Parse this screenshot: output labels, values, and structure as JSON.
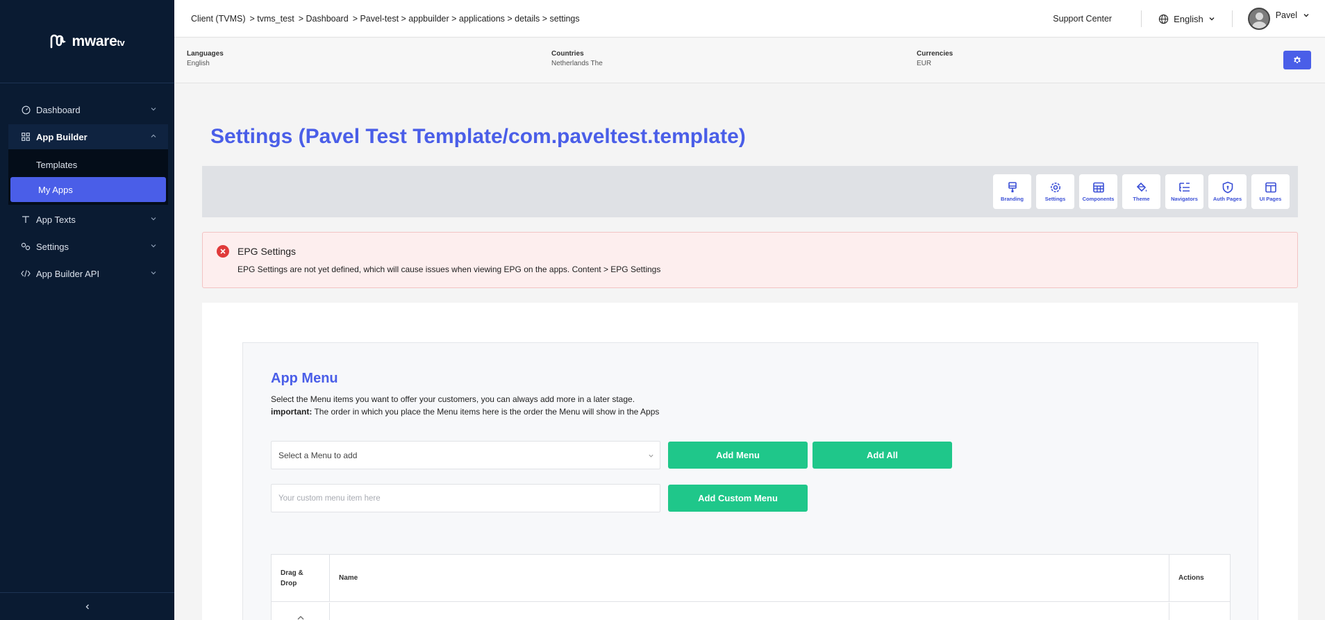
{
  "sidebar": {
    "logo_text": "mware",
    "logo_suffix": "tv",
    "items": [
      {
        "label": "Dashboard"
      },
      {
        "label": "App Builder"
      },
      {
        "label": "App Texts"
      },
      {
        "label": "Settings"
      },
      {
        "label": "App Builder API"
      }
    ],
    "sub_items": [
      {
        "label": "Templates"
      },
      {
        "label": "My Apps"
      }
    ]
  },
  "topbar": {
    "breadcrumb": [
      "Client (TVMS)",
      "> tvms_test",
      "> Dashboard",
      "> Pavel-test > appbuilder > applications > details > settings"
    ],
    "support_label": "Support Center",
    "language": "English",
    "user_name": "Pavel"
  },
  "info": {
    "languages_label": "Languages",
    "languages_value": "English",
    "countries_label": "Countries",
    "countries_value": "Netherlands The",
    "currencies_label": "Currencies",
    "currencies_value": "EUR"
  },
  "page": {
    "title": "Settings (Pavel Test Template/com.paveltest.template)"
  },
  "tools": [
    {
      "label": "Branding",
      "icon": "brush-icon"
    },
    {
      "label": "Settings",
      "icon": "gear-icon"
    },
    {
      "label": "Components",
      "icon": "grid-icon"
    },
    {
      "label": "Theme",
      "icon": "paint-bucket-icon"
    },
    {
      "label": "Navigators",
      "icon": "list-tree-icon"
    },
    {
      "label": "Auth Pages",
      "icon": "shield-icon"
    },
    {
      "label": "UI Pages",
      "icon": "layout-icon"
    }
  ],
  "alert": {
    "title": "EPG Settings",
    "message": "EPG Settings are not yet defined, which will cause issues when viewing EPG on the apps. Content > EPG Settings"
  },
  "app_menu": {
    "title": "App Menu",
    "desc_line1": "Select the Menu items you want to offer your customers, you can always add more in a later stage.",
    "desc_important": "important:",
    "desc_line2": " The order in which you place the Menu items here is the order the Menu will show in the Apps",
    "select_placeholder": "Select a Menu to add",
    "add_menu_label": "Add Menu",
    "add_all_label": "Add All",
    "custom_placeholder": "Your custom menu item here",
    "add_custom_label": "Add Custom Menu",
    "table_headers": [
      "Drag &\nDrop",
      "Name",
      "Actions"
    ]
  },
  "colors": {
    "accent": "#4a5ee8",
    "sidebar_bg": "#0a1b32",
    "success": "#1fc78a",
    "danger": "#e03a3a"
  }
}
